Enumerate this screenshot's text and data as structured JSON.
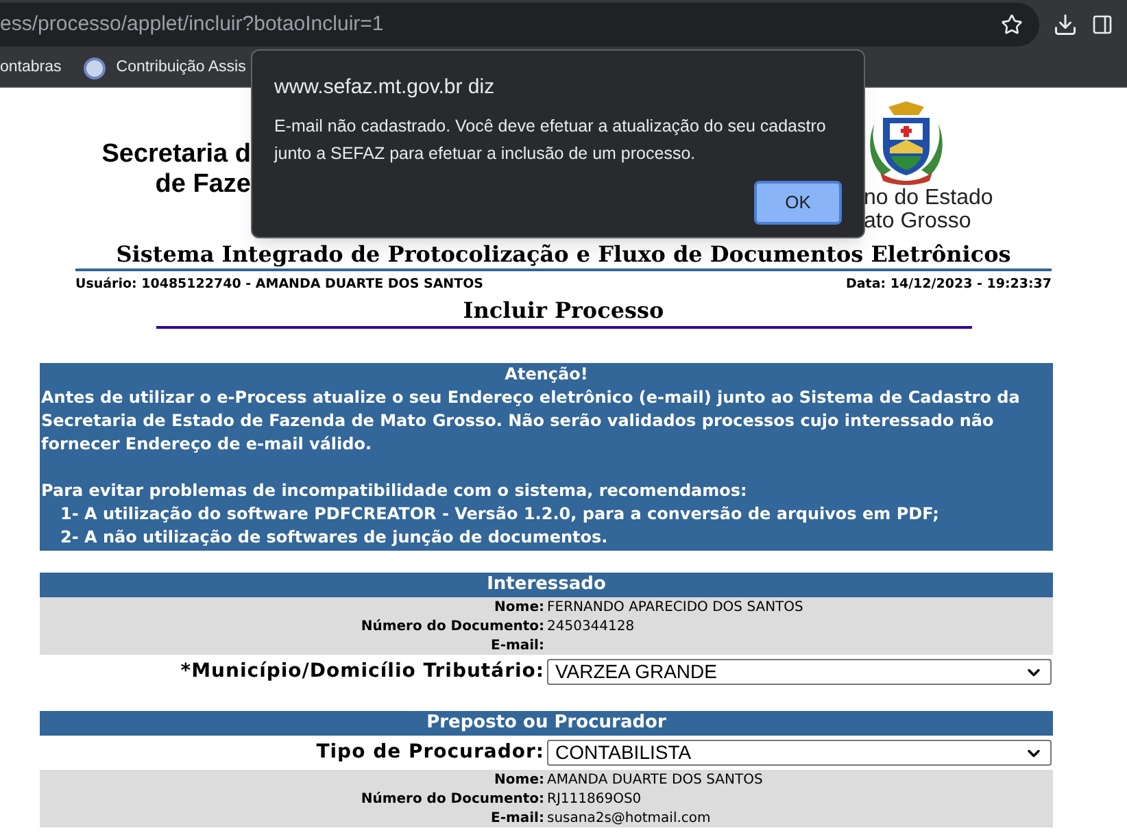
{
  "browser": {
    "url": "ess/processo/applet/incluir?botaoIncluir=1",
    "bookmarks": [
      {
        "label": "ontabras",
        "icon": false
      },
      {
        "label": "Contribuição Assis",
        "icon": true
      }
    ]
  },
  "dialog": {
    "origin": "www.sefaz.mt.gov.br diz",
    "message": "E-mail não cadastrado. Você deve efetuar a atualização do seu cadastro junto a SEFAZ para efetuar a inclusão de um processo.",
    "button": "OK"
  },
  "header": {
    "logo_left_lines": [
      "Secretaria d",
      "de Faze"
    ],
    "logo_right_lines": [
      "no do Estado",
      "ato Grosso"
    ],
    "system_title": "Sistema Integrado de Protocolização e Fluxo de Documentos Eletrônicos",
    "user": "Usuário: 10485122740 - AMANDA DUARTE DOS SANTOS",
    "date": "Data: 14/12/2023 - 19:23:37"
  },
  "page_title": "Incluir Processo",
  "notice": {
    "title": "Atenção!",
    "paragraphs": [
      "Antes de utilizar o e-Process atualize o seu Endereço eletrônico (e-mail) junto ao Sistema de Cadastro da Secretaria de Estado de Fazenda de Mato Grosso. Não serão validados processos cujo interessado não fornecer Endereço de e-mail válido.",
      "Para evitar problemas de incompatibilidade com o sistema, recomendamos:"
    ],
    "items": [
      "1- A utilização do software PDFCREATOR - Versão 1.2.0, para a conversão de arquivos em PDF;",
      "2- A não utilização de softwares de junção de documentos."
    ]
  },
  "sections": [
    {
      "title": "Interessado",
      "rows": [
        {
          "kind": "info",
          "label": "Nome:",
          "value": "FERNANDO APARECIDO DOS SANTOS"
        },
        {
          "kind": "info",
          "label": "Número do Documento:",
          "value": "2450344128"
        },
        {
          "kind": "info",
          "label": "E-mail:"
        },
        {
          "kind": "select",
          "label": "*Município/Domicílio Tributário:",
          "value": "VARZEA GRANDE"
        }
      ]
    },
    {
      "title": "Preposto ou Procurador",
      "rows": [
        {
          "kind": "select",
          "label": "Tipo de Procurador:",
          "value": "CONTABILISTA"
        },
        {
          "kind": "info",
          "label": "Nome:",
          "value": "AMANDA DUARTE DOS SANTOS"
        },
        {
          "kind": "info",
          "label": "Número do Documento:",
          "value": "RJ111869OS0"
        },
        {
          "kind": "info",
          "label": "E-mail:",
          "value": "susana2s@hotmail.com"
        }
      ]
    }
  ]
}
